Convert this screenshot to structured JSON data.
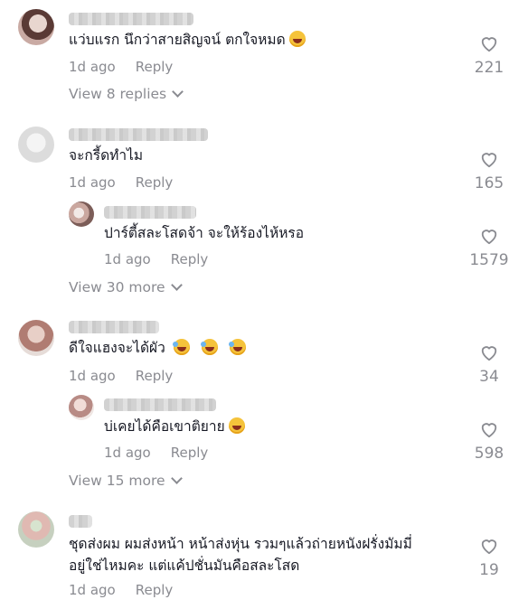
{
  "comments": [
    {
      "text": "แว่บแรก นึกว่าสายสิญจน์ ตกใจหมด",
      "time": "1d ago",
      "reply_label": "Reply",
      "likes": "221",
      "view_more": "View 8 replies"
    },
    {
      "text": "จะกรี้ดทำไม",
      "time": "1d ago",
      "reply_label": "Reply",
      "likes": "165",
      "reply": {
        "text": "ปาร์ตี้สละโสดจ้า จะให้ร้องไห้หรอ",
        "time": "1d ago",
        "reply_label": "Reply",
        "likes": "1579"
      },
      "view_more": "View 30 more"
    },
    {
      "text": "ดีใจแฮงจะได้ผัว",
      "time": "1d ago",
      "reply_label": "Reply",
      "likes": "34",
      "reply": {
        "text": "บ่เคยได้คือเขาติยาย",
        "time": "1d ago",
        "reply_label": "Reply",
        "likes": "598"
      },
      "view_more": "View 15 more"
    },
    {
      "text_line1": "ชุดส่งผม ผมส่งหน้า หน้าส่งหุ่น รวมๆแล้วถ่ายหนังฝรั่งมัมมี่",
      "text_line2": "อยู่ใช่ไหมคะ แต่แค้ปชั่นมันคือสละโสด",
      "time": "1d ago",
      "reply_label": "Reply",
      "likes": "19"
    }
  ],
  "icons": {
    "like": "heart-outline-icon",
    "expand": "chevron-down-icon",
    "emoji": "grinning-face-emoji"
  },
  "colors": {
    "text": "#161823",
    "muted": "#8a8b91",
    "background": "#ffffff"
  }
}
